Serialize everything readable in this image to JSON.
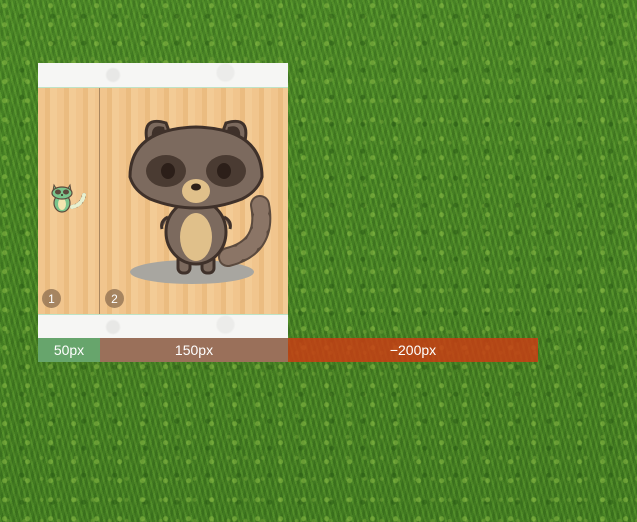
{
  "panels": [
    {
      "number": "1"
    },
    {
      "number": "2"
    }
  ],
  "bars": {
    "first": "50px",
    "second": "150px",
    "third": "−200px"
  },
  "icons": [
    "raccoon-mini-icon",
    "raccoon-icon"
  ],
  "colors": {
    "bar_first": "#67a56c",
    "bar_second": "#9a705a",
    "bar_third": "#cd3c14",
    "wood": "#f1c58d"
  }
}
